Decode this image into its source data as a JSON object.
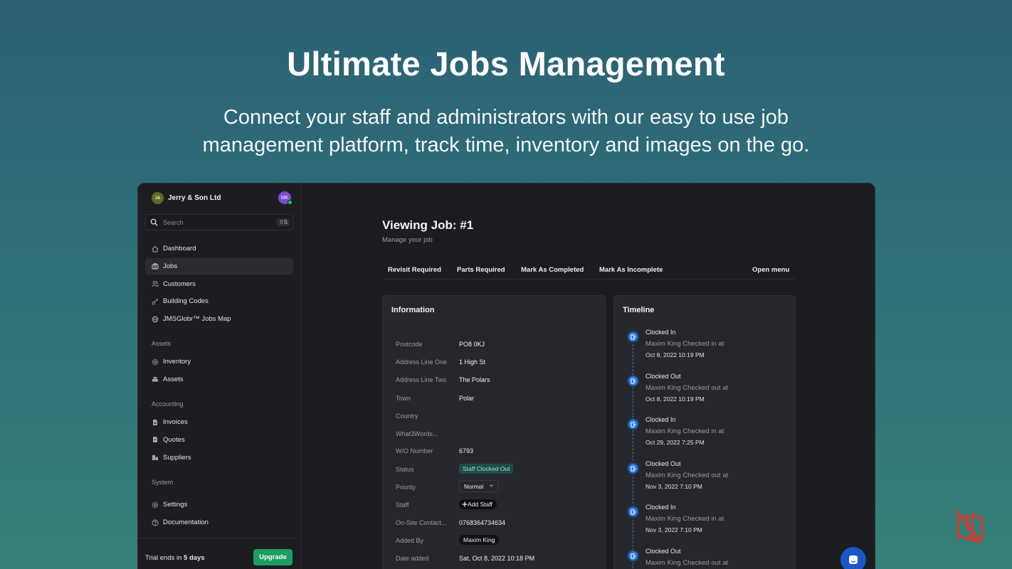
{
  "hero": {
    "title": "Ultimate Jobs Management",
    "subtitle_line1": "Connect your staff and administrators with our easy to use job",
    "subtitle_line2": "management platform, track time, inventory and images on the go."
  },
  "sidebar": {
    "org_initials": "J&",
    "org_name": "Jerry & Son Ltd",
    "user_initials": "MK",
    "search": {
      "placeholder": "Search",
      "shortcut": "⇧S"
    },
    "main_items": [
      {
        "label": "Dashboard",
        "icon": "home-icon"
      },
      {
        "label": "Jobs",
        "icon": "briefcase-icon",
        "active": true
      },
      {
        "label": "Customers",
        "icon": "users-icon"
      },
      {
        "label": "Building Codes",
        "icon": "key-icon"
      },
      {
        "label": "JMSGlobr™ Jobs Map",
        "icon": "globe-icon"
      }
    ],
    "sections": {
      "assets": "Assets",
      "accounting": "Accounting",
      "system": "System"
    },
    "assets_items": [
      {
        "label": "Inventory",
        "icon": "cog-icon"
      },
      {
        "label": "Assets",
        "icon": "stack-icon"
      }
    ],
    "accounting_items": [
      {
        "label": "Invoices",
        "icon": "document-icon"
      },
      {
        "label": "Quotes",
        "icon": "document-icon"
      },
      {
        "label": "Suppliers",
        "icon": "building-icon"
      }
    ],
    "system_items": [
      {
        "label": "Settings",
        "icon": "gear-icon"
      },
      {
        "label": "Documentation",
        "icon": "help-icon"
      }
    ],
    "trial": {
      "prefix": "Trial ends in ",
      "days": "5 days"
    },
    "upgrade_label": "Upgrade"
  },
  "main": {
    "title": "Viewing Job: #1",
    "subtitle": "Manage your job",
    "actions": {
      "revisit": "Revisit Required",
      "parts": "Parts Required",
      "completed": "Mark As Completed",
      "incomplete": "Mark As Incomplete",
      "menu": "Open menu"
    },
    "information": {
      "title": "Information",
      "postcode": {
        "label": "Postcode",
        "value": "PO8 0KJ"
      },
      "address1": {
        "label": "Address Line One",
        "value": "1 High St"
      },
      "address2": {
        "label": "Address Line Two",
        "value": "The Polars"
      },
      "town": {
        "label": "Town",
        "value": "Polar"
      },
      "country": {
        "label": "Country",
        "value": ""
      },
      "what3words": {
        "label": "What3Words...",
        "value": ""
      },
      "wo_number": {
        "label": "W/O Number",
        "value": "6793"
      },
      "status": {
        "label": "Status",
        "value": "Staff Clocked Out"
      },
      "priority": {
        "label": "Priority",
        "value": "Normal"
      },
      "staff": {
        "label": "Staff",
        "value": "Add Staff"
      },
      "onsite": {
        "label": "On-Site Contact...",
        "value": "0768364734634"
      },
      "added_by": {
        "label": "Added By",
        "value": "Maxim King"
      },
      "date_added": {
        "label": "Date added",
        "value": "Sat, Oct 8, 2022 10:18 PM"
      }
    },
    "timeline": {
      "title": "Timeline",
      "events": [
        {
          "title": "Clocked In",
          "desc": "Maxim King Checked in at",
          "time": "Oct 8, 2022 10:19 PM"
        },
        {
          "title": "Clocked Out",
          "desc": "Maxim King Checked out at",
          "time": "Oct 8, 2022 10:19 PM"
        },
        {
          "title": "Clocked In",
          "desc": "Maxim King Checked in at",
          "time": "Oct 29, 2022 7:25 PM"
        },
        {
          "title": "Clocked Out",
          "desc": "Maxim King Checked out at",
          "time": "Nov 3, 2022 7:10 PM"
        },
        {
          "title": "Clocked In",
          "desc": "Maxim King Checked in at",
          "time": "Nov 3, 2022 7:10 PM"
        },
        {
          "title": "Clocked Out",
          "desc": "Maxim King Checked out at",
          "time": ""
        }
      ]
    }
  },
  "colors": {
    "accent": "#1f9d62",
    "timeline_dot": "#2f7be0",
    "status_badge": "#1f4c4a"
  }
}
